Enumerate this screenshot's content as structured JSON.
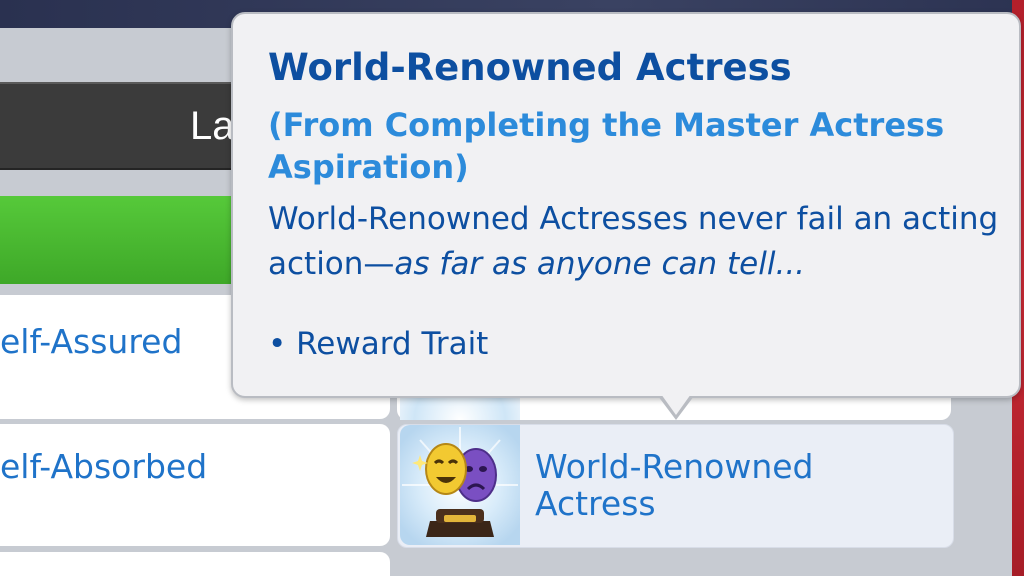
{
  "header": {
    "partial_title": "La"
  },
  "trait_list": {
    "left_items": [
      {
        "label": "elf-Assured"
      },
      {
        "label": "elf-Absorbed"
      }
    ],
    "right_items": [
      {
        "label": "World-Renowned Actress",
        "icon": "comedy-tragedy-masks-trophy-icon"
      }
    ]
  },
  "tooltip": {
    "title": "World-Renowned Actress",
    "subtitle": "(From Completing the Master Actress Aspiration)",
    "description_plain": "World-Renowned Actresses never fail an acting action—",
    "description_italic": "as far as anyone can tell...",
    "bullet": "• Reward Trait"
  },
  "colors": {
    "title_blue": "#0d4fa1",
    "subtitle_blue": "#2c8bdb",
    "label_blue": "#1f73c9",
    "progress_green": "#4ab832",
    "accent_red": "#c82a35"
  }
}
